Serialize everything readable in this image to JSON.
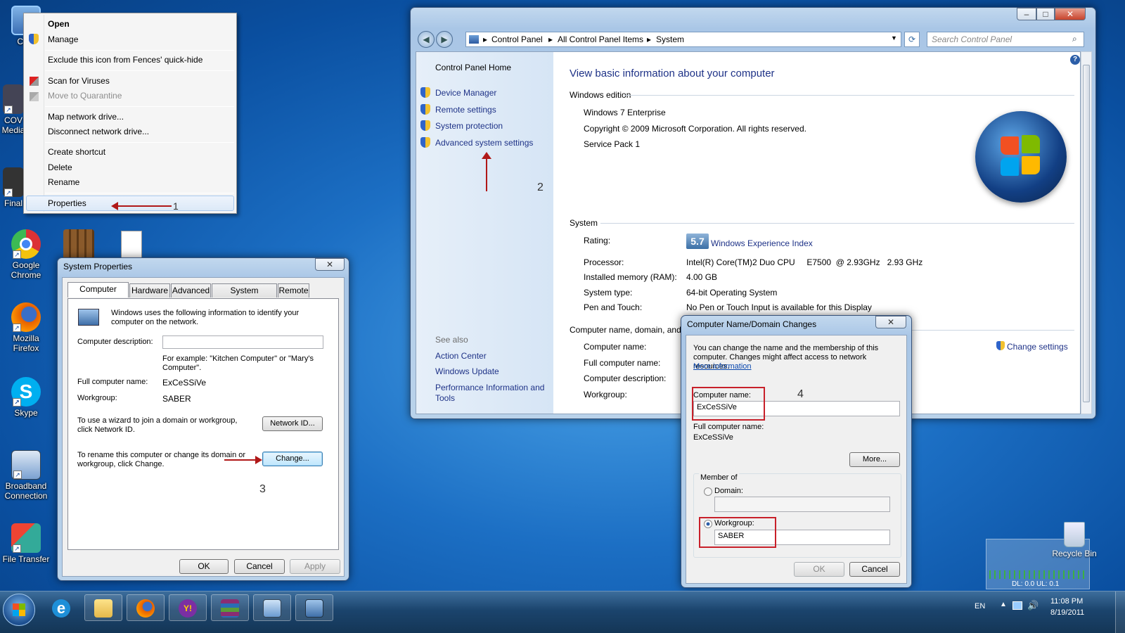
{
  "desktop": {
    "icons": [
      {
        "label": "Com"
      },
      {
        "label": "COV Media"
      },
      {
        "label": "Final"
      },
      {
        "label": "Google Chrome"
      },
      {
        "label": "Mozilla Firefox"
      },
      {
        "label": "Skype"
      },
      {
        "label": "Broadband Connection"
      },
      {
        "label": "File Transfer"
      },
      {
        "label": "Recycle Bin"
      }
    ],
    "netmeter": "DL: 0.0  UL: 0.1"
  },
  "context_menu": {
    "items": [
      "Open",
      "Manage",
      "Exclude this icon from Fences' quick-hide",
      "Scan for Viruses",
      "Move to Quarantine",
      "Map network drive...",
      "Disconnect network drive...",
      "Create shortcut",
      "Delete",
      "Rename",
      "Properties"
    ]
  },
  "steps": [
    "1",
    "2",
    "3",
    "4"
  ],
  "control_panel": {
    "breadcrumb": [
      "Control Panel",
      "All Control Panel Items",
      "System"
    ],
    "search_placeholder": "Search Control Panel",
    "home": "Control Panel Home",
    "tasks": [
      "Device Manager",
      "Remote settings",
      "System protection",
      "Advanced system settings"
    ],
    "see_also_title": "See also",
    "see_also": [
      "Action Center",
      "Windows Update",
      "Performance Information and Tools"
    ],
    "heading": "View basic information about your computer",
    "edition_title": "Windows edition",
    "edition_lines": [
      "Windows 7 Enterprise",
      "Copyright © 2009 Microsoft Corporation.  All rights reserved.",
      "Service Pack 1"
    ],
    "system_title": "System",
    "rating_label": "Rating:",
    "rating_value": "5.7",
    "rating_link": "Windows Experience Index",
    "specs": [
      {
        "label": "Processor:",
        "value": "Intel(R) Core(TM)2 Duo CPU     E7500  @ 2.93GHz   2.93 GHz"
      },
      {
        "label": "Installed memory (RAM):",
        "value": "4.00 GB"
      },
      {
        "label": "System type:",
        "value": "64-bit Operating System"
      },
      {
        "label": "Pen and Touch:",
        "value": "No Pen or Touch Input is available for this Display"
      }
    ],
    "name_title": "Computer name, domain, and",
    "name_labels": [
      "Computer name:",
      "Full computer name:",
      "Computer description:",
      "Workgroup:"
    ],
    "change_settings": "Change settings"
  },
  "sys_props": {
    "title": "System Properties",
    "tabs": [
      "Computer Name",
      "Hardware",
      "Advanced",
      "System Protection",
      "Remote"
    ],
    "intro": "Windows uses the following information to identify your computer on the network.",
    "desc_label": "Computer description:",
    "desc_value": "",
    "example": "For example: \"Kitchen Computer\" or \"Mary's Computer\".",
    "full_name_label": "Full computer name:",
    "full_name_value": "ExCeSSiVe",
    "workgroup_label": "Workgroup:",
    "workgroup_value": "SABER",
    "wizard_text": "To use a wizard to join a domain or workgroup, click Network ID.",
    "network_id": "Network ID...",
    "rename_text": "To rename this computer or change its domain or workgroup, click Change.",
    "change": "Change...",
    "ok": "OK",
    "cancel": "Cancel",
    "apply": "Apply"
  },
  "name_changes": {
    "title": "Computer Name/Domain Changes",
    "intro": "You can change the name and the membership of this computer. Changes might affect access to network resources.",
    "more_info": "More information",
    "name_label": "Computer name:",
    "name_value": "ExCeSSiVe",
    "full_label": "Full computer name:",
    "full_value": "ExCeSSiVe",
    "more": "More...",
    "member_of": "Member of",
    "domain_label": "Domain:",
    "domain_value": "",
    "workgroup_label": "Workgroup:",
    "workgroup_value": "SABER",
    "ok": "OK",
    "cancel": "Cancel"
  },
  "taskbar": {
    "lang": "EN",
    "time": "11:08 PM",
    "date": "8/19/2011"
  }
}
